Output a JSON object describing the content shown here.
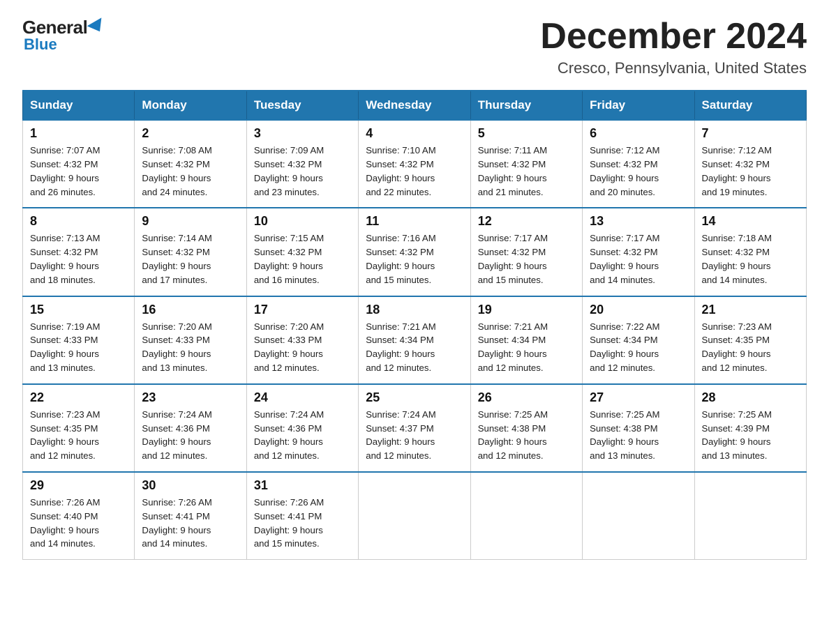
{
  "logo": {
    "name": "General",
    "name2": "Blue"
  },
  "header": {
    "title": "December 2024",
    "location": "Cresco, Pennsylvania, United States"
  },
  "days_of_week": [
    "Sunday",
    "Monday",
    "Tuesday",
    "Wednesday",
    "Thursday",
    "Friday",
    "Saturday"
  ],
  "weeks": [
    [
      {
        "day": "1",
        "sunrise": "7:07 AM",
        "sunset": "4:32 PM",
        "daylight": "9 hours and 26 minutes."
      },
      {
        "day": "2",
        "sunrise": "7:08 AM",
        "sunset": "4:32 PM",
        "daylight": "9 hours and 24 minutes."
      },
      {
        "day": "3",
        "sunrise": "7:09 AM",
        "sunset": "4:32 PM",
        "daylight": "9 hours and 23 minutes."
      },
      {
        "day": "4",
        "sunrise": "7:10 AM",
        "sunset": "4:32 PM",
        "daylight": "9 hours and 22 minutes."
      },
      {
        "day": "5",
        "sunrise": "7:11 AM",
        "sunset": "4:32 PM",
        "daylight": "9 hours and 21 minutes."
      },
      {
        "day": "6",
        "sunrise": "7:12 AM",
        "sunset": "4:32 PM",
        "daylight": "9 hours and 20 minutes."
      },
      {
        "day": "7",
        "sunrise": "7:12 AM",
        "sunset": "4:32 PM",
        "daylight": "9 hours and 19 minutes."
      }
    ],
    [
      {
        "day": "8",
        "sunrise": "7:13 AM",
        "sunset": "4:32 PM",
        "daylight": "9 hours and 18 minutes."
      },
      {
        "day": "9",
        "sunrise": "7:14 AM",
        "sunset": "4:32 PM",
        "daylight": "9 hours and 17 minutes."
      },
      {
        "day": "10",
        "sunrise": "7:15 AM",
        "sunset": "4:32 PM",
        "daylight": "9 hours and 16 minutes."
      },
      {
        "day": "11",
        "sunrise": "7:16 AM",
        "sunset": "4:32 PM",
        "daylight": "9 hours and 15 minutes."
      },
      {
        "day": "12",
        "sunrise": "7:17 AM",
        "sunset": "4:32 PM",
        "daylight": "9 hours and 15 minutes."
      },
      {
        "day": "13",
        "sunrise": "7:17 AM",
        "sunset": "4:32 PM",
        "daylight": "9 hours and 14 minutes."
      },
      {
        "day": "14",
        "sunrise": "7:18 AM",
        "sunset": "4:32 PM",
        "daylight": "9 hours and 14 minutes."
      }
    ],
    [
      {
        "day": "15",
        "sunrise": "7:19 AM",
        "sunset": "4:33 PM",
        "daylight": "9 hours and 13 minutes."
      },
      {
        "day": "16",
        "sunrise": "7:20 AM",
        "sunset": "4:33 PM",
        "daylight": "9 hours and 13 minutes."
      },
      {
        "day": "17",
        "sunrise": "7:20 AM",
        "sunset": "4:33 PM",
        "daylight": "9 hours and 12 minutes."
      },
      {
        "day": "18",
        "sunrise": "7:21 AM",
        "sunset": "4:34 PM",
        "daylight": "9 hours and 12 minutes."
      },
      {
        "day": "19",
        "sunrise": "7:21 AM",
        "sunset": "4:34 PM",
        "daylight": "9 hours and 12 minutes."
      },
      {
        "day": "20",
        "sunrise": "7:22 AM",
        "sunset": "4:34 PM",
        "daylight": "9 hours and 12 minutes."
      },
      {
        "day": "21",
        "sunrise": "7:23 AM",
        "sunset": "4:35 PM",
        "daylight": "9 hours and 12 minutes."
      }
    ],
    [
      {
        "day": "22",
        "sunrise": "7:23 AM",
        "sunset": "4:35 PM",
        "daylight": "9 hours and 12 minutes."
      },
      {
        "day": "23",
        "sunrise": "7:24 AM",
        "sunset": "4:36 PM",
        "daylight": "9 hours and 12 minutes."
      },
      {
        "day": "24",
        "sunrise": "7:24 AM",
        "sunset": "4:36 PM",
        "daylight": "9 hours and 12 minutes."
      },
      {
        "day": "25",
        "sunrise": "7:24 AM",
        "sunset": "4:37 PM",
        "daylight": "9 hours and 12 minutes."
      },
      {
        "day": "26",
        "sunrise": "7:25 AM",
        "sunset": "4:38 PM",
        "daylight": "9 hours and 12 minutes."
      },
      {
        "day": "27",
        "sunrise": "7:25 AM",
        "sunset": "4:38 PM",
        "daylight": "9 hours and 13 minutes."
      },
      {
        "day": "28",
        "sunrise": "7:25 AM",
        "sunset": "4:39 PM",
        "daylight": "9 hours and 13 minutes."
      }
    ],
    [
      {
        "day": "29",
        "sunrise": "7:26 AM",
        "sunset": "4:40 PM",
        "daylight": "9 hours and 14 minutes."
      },
      {
        "day": "30",
        "sunrise": "7:26 AM",
        "sunset": "4:41 PM",
        "daylight": "9 hours and 14 minutes."
      },
      {
        "day": "31",
        "sunrise": "7:26 AM",
        "sunset": "4:41 PM",
        "daylight": "9 hours and 15 minutes."
      },
      null,
      null,
      null,
      null
    ]
  ],
  "labels": {
    "sunrise": "Sunrise:",
    "sunset": "Sunset:",
    "daylight": "Daylight:"
  }
}
